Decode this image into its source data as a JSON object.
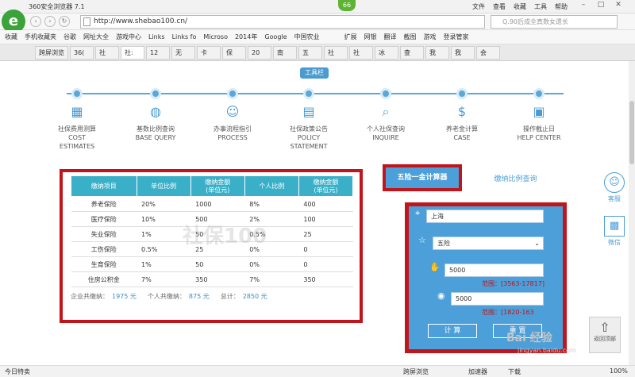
{
  "browser": {
    "title": "360安全浏览器 7.1",
    "badge": "66",
    "menus": [
      "文件",
      "查看",
      "收藏",
      "工具",
      "帮助"
    ],
    "url": "http://www.shebao100.cn/",
    "search_placeholder": "Q.90后成全真数女遗长",
    "bookmarks": [
      "收藏",
      "手机收藏夹",
      "谷歌",
      "网址大全",
      "游戏中心",
      "Links",
      "Links fo",
      "Microso",
      "2014年",
      "Google",
      "中国农业"
    ],
    "bookmarks_right": [
      "扩展",
      "网银",
      "翻译",
      "截图",
      "游戏",
      "登录管家"
    ],
    "tabs": [
      "跨屏浏览",
      "36(",
      "社",
      "社:",
      "12",
      "无",
      "卡",
      "保",
      "20",
      "南",
      "五",
      "社",
      "社",
      "冰",
      "查",
      "我",
      "我",
      "会",
      "我",
      "25",
      "个",
      "+"
    ]
  },
  "nav": {
    "badge": "工具栏",
    "items": [
      {
        "zh": "社保费用测算",
        "en1": "COST",
        "en2": "ESTIMATES",
        "icon": "calculator-icon"
      },
      {
        "zh": "基数比例查询",
        "en1": "BASE QUERY",
        "en2": "",
        "icon": "globe-icon"
      },
      {
        "zh": "办事流程指引",
        "en1": "PROCESS",
        "en2": "",
        "icon": "user-icon"
      },
      {
        "zh": "社保政策公告",
        "en1": "POLICY",
        "en2": "STATEMENT",
        "icon": "document-icon"
      },
      {
        "zh": "个人社保查询",
        "en1": "INQUIRE",
        "en2": "",
        "icon": "search-icon"
      },
      {
        "zh": "养老金计算",
        "en1": "CASE",
        "en2": "",
        "icon": "money-bag-icon"
      },
      {
        "zh": "操作截止日",
        "en1": "HELP CENTER",
        "en2": "",
        "icon": "calendar-icon"
      }
    ]
  },
  "table": {
    "headers": [
      "缴纳项目",
      "单位比例",
      "缴纳金额\n(单位元)",
      "个人比例",
      "缴纳金额\n(单位元)"
    ],
    "rows": [
      [
        "养老保险",
        "20%",
        "1000",
        "8%",
        "400"
      ],
      [
        "医疗保险",
        "10%",
        "500",
        "2%",
        "100"
      ],
      [
        "失业保险",
        "1%",
        "50",
        "0.5%",
        "25"
      ],
      [
        "工伤保险",
        "0.5%",
        "25",
        "0%",
        "0"
      ],
      [
        "生育保险",
        "1%",
        "50",
        "0%",
        "0"
      ],
      [
        "住房公积金",
        "7%",
        "350",
        "7%",
        "350"
      ]
    ],
    "summary": {
      "company_label": "企业共缴纳：",
      "company_value": "1975 元",
      "personal_label": "个人共缴纳：",
      "personal_value": "875 元",
      "total_label": "总计：",
      "total_value": "2850 元"
    },
    "watermark": "社保100"
  },
  "calculator": {
    "tab_active": "五险一金计算器",
    "tab_inactive": "缴纳比例查询",
    "city": "上海",
    "scheme": "五险",
    "base1": "5000",
    "range1": "范围：[3563-17817]",
    "base2": "5000",
    "range2": "范围：[1820-163",
    "compute": "计 算",
    "reset": "重 置"
  },
  "side": {
    "service": "客服",
    "wechat": "微信",
    "backtop": "返回顶部"
  },
  "watermark": {
    "text": "Bai 经验",
    "sub": "jingyan.baidu.com"
  },
  "status": {
    "left": "今日特卖",
    "mid1": "跨屏浏览",
    "mid2": "加速器",
    "mid3": "下载",
    "zoom": "100%"
  }
}
